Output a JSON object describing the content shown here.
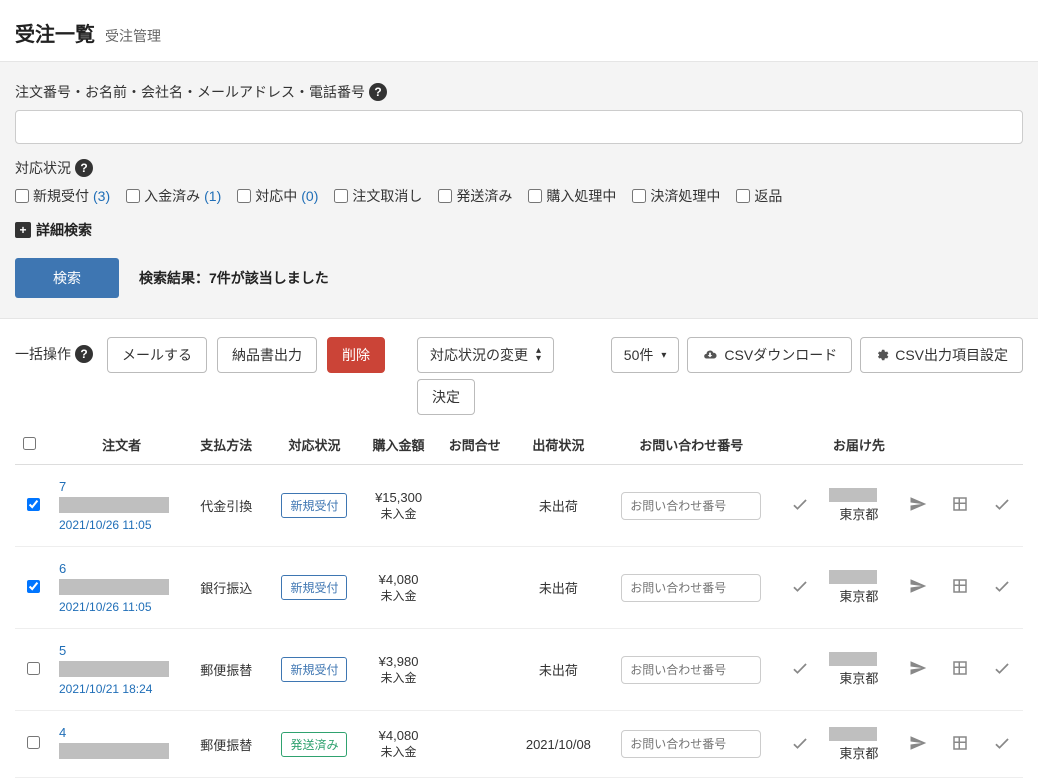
{
  "header": {
    "title": "受注一覧",
    "subtitle": "受注管理"
  },
  "search": {
    "keyword_label": "注文番号・お名前・会社名・メールアドレス・電話番号",
    "status_label": "対応状況",
    "statuses": [
      {
        "label": "新規受付",
        "count": "(3)",
        "count_class": "count-blue"
      },
      {
        "label": "入金済み",
        "count": "(1)",
        "count_class": "count-blue"
      },
      {
        "label": "対応中",
        "count": "(0)",
        "count_class": "count-blue"
      },
      {
        "label": "注文取消し",
        "count": ""
      },
      {
        "label": "発送済み",
        "count": ""
      },
      {
        "label": "購入処理中",
        "count": ""
      },
      {
        "label": "決済処理中",
        "count": ""
      },
      {
        "label": "返品",
        "count": ""
      }
    ],
    "advanced_label": "詳細検索",
    "button_label": "検索",
    "result_text": "検索結果：7件が該当しました"
  },
  "toolbar": {
    "bulk_label": "一括操作",
    "mail_label": "メールする",
    "slip_label": "納品書出力",
    "delete_label": "削除",
    "status_change_label": "対応状況の変更",
    "decide_label": "決定",
    "per_page_label": "50件",
    "csv_download_label": "CSVダウンロード",
    "csv_settings_label": "CSV出力項目設定"
  },
  "table": {
    "headers": {
      "orderer": "注文者",
      "payment": "支払方法",
      "status": "対応状況",
      "amount": "購入金額",
      "inquiry": "お問合せ",
      "ship_status": "出荷状況",
      "tracking": "お問い合わせ番号",
      "destination": "お届け先"
    },
    "tracking_placeholder": "お問い合わせ番号",
    "rows": [
      {
        "checked": true,
        "order_no": "7",
        "order_date": "2021/10/26 11:05",
        "payment": "代金引換",
        "status": "新規受付",
        "status_class": "badge-blue",
        "amount": "¥15,300",
        "pay_status": "未入金",
        "ship_date": "",
        "ship_status": "未出荷",
        "destination": "東京都"
      },
      {
        "checked": true,
        "order_no": "6",
        "order_date": "2021/10/26 11:05",
        "payment": "銀行振込",
        "status": "新規受付",
        "status_class": "badge-blue",
        "amount": "¥4,080",
        "pay_status": "未入金",
        "ship_date": "",
        "ship_status": "未出荷",
        "destination": "東京都"
      },
      {
        "checked": false,
        "order_no": "5",
        "order_date": "2021/10/21 18:24",
        "payment": "郵便振替",
        "status": "新規受付",
        "status_class": "badge-blue",
        "amount": "¥3,980",
        "pay_status": "未入金",
        "ship_date": "",
        "ship_status": "未出荷",
        "destination": "東京都"
      },
      {
        "checked": false,
        "order_no": "4",
        "order_date": "",
        "payment": "郵便振替",
        "status": "発送済み",
        "status_class": "badge-green",
        "amount": "¥4,080",
        "pay_status": "未入金",
        "ship_date": "2021/10/08",
        "ship_status": "",
        "destination": "東京都"
      }
    ]
  }
}
